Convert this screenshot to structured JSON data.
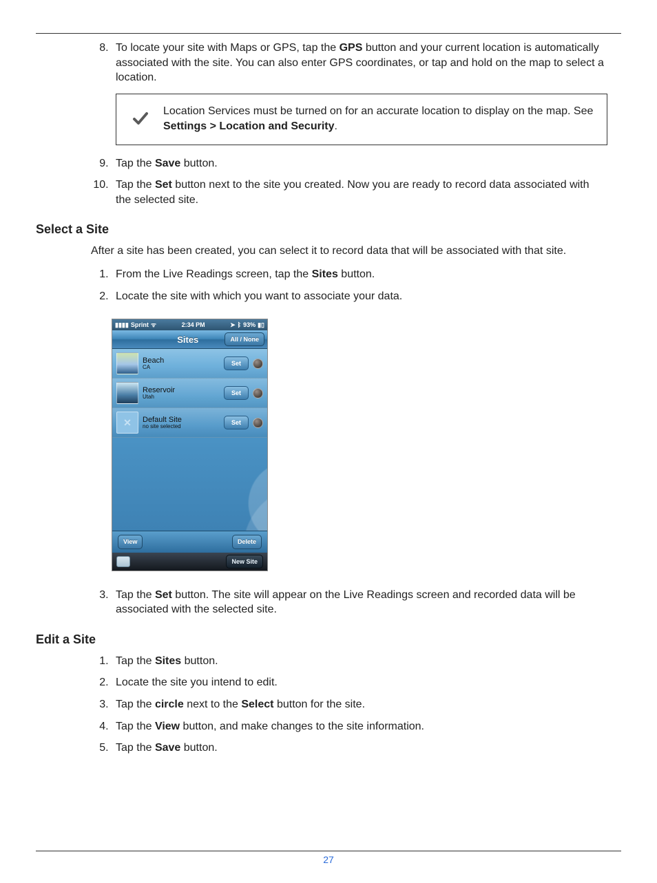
{
  "step8": {
    "prefix": "To locate your site with Maps or GPS, tap the ",
    "bold": "GPS",
    "suffix": " button and your current location is automatically associated with the site. You can also enter GPS coordinates, or tap and hold on the map to select a location."
  },
  "note": {
    "prefix": "Location Services must be turned on for an accurate location to display on the map. See ",
    "boldpath": "Settings > Location and Security",
    "suffix": "."
  },
  "step9": {
    "prefix": "Tap the ",
    "bold": "Save",
    "suffix": " button."
  },
  "step10": {
    "prefix": "Tap the ",
    "bold": "Set",
    "suffix": " button next to the site you created. Now you are ready to record data associated with the selected site."
  },
  "section_select": {
    "heading": "Select a Site",
    "intro": "After a site has been created, you can select it to record data that will be associated with that site.",
    "li1": {
      "prefix": "From the Live Readings screen, tap the ",
      "bold": "Sites",
      "suffix": " button."
    },
    "li2": "Locate the site with which you want to associate your data.",
    "li3": {
      "prefix": "Tap the ",
      "bold": "Set",
      "suffix": " button. The site will appear on the Live Readings screen and recorded data will be associated with the selected site."
    }
  },
  "section_edit": {
    "heading": "Edit a Site",
    "li1": {
      "prefix": "Tap the ",
      "bold": "Sites",
      "suffix": " button."
    },
    "li2": "Locate the site you intend to edit.",
    "li3": {
      "prefix": "Tap the ",
      "bold1": "circle",
      "mid": " next to the ",
      "bold2": "Select",
      "suffix": " button for the site."
    },
    "li4": {
      "prefix": "Tap the ",
      "bold": "View",
      "suffix": " button, and make changes to the site information."
    },
    "li5": {
      "prefix": "Tap the ",
      "bold": "Save",
      "suffix": " button."
    }
  },
  "phone": {
    "status": {
      "carrier": "Sprint",
      "time": "2:34 PM",
      "battery": "93%"
    },
    "nav": {
      "title": "Sites",
      "allnone": "All / None"
    },
    "rows": [
      {
        "name": "Beach",
        "sub": "CA",
        "btn": "Set"
      },
      {
        "name": "Reservoir",
        "sub": "Utah",
        "btn": "Set"
      },
      {
        "name": "Default Site",
        "sub": "no site selected",
        "btn": "Set"
      }
    ],
    "bottom": {
      "view": "View",
      "delete": "Delete",
      "newsite": "New Site"
    }
  },
  "page_number": "27"
}
